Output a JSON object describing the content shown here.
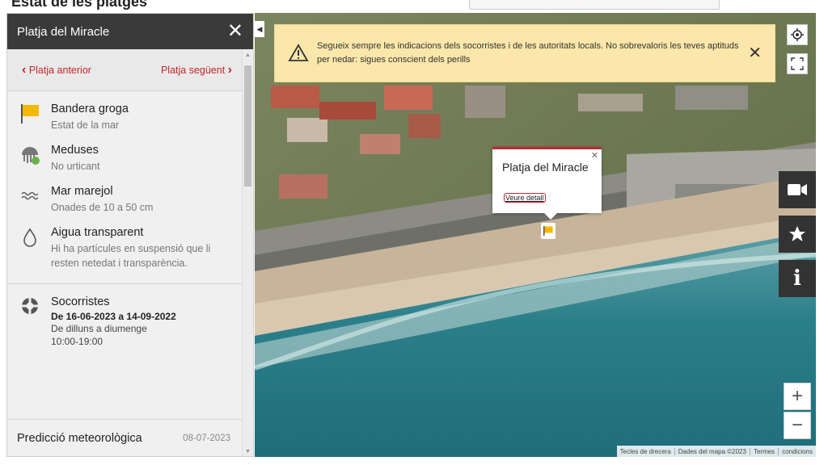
{
  "page": {
    "title": "Estat de les platges",
    "search_placeholder": "",
    "more_text": ""
  },
  "panel": {
    "title": "Platja del Miracle",
    "prev_label": "Platja anterior",
    "next_label": "Platja següent",
    "items": [
      {
        "title": "Bandera groga",
        "subtitle": "Estat de la mar"
      },
      {
        "title": "Meduses",
        "subtitle": "No urticant"
      },
      {
        "title": "Mar marejol",
        "subtitle": "Onades de 10 a 50 cm"
      },
      {
        "title": "Aigua transparent",
        "subtitle": "Hi ha partícules en suspensió que li resten netedat i transparència."
      }
    ],
    "lifeguards": {
      "title": "Socorristes",
      "dates": "De 16-06-2023 a 14-09-2022",
      "days": "De dilluns a diumenge",
      "hours": "10:00-19:00"
    },
    "forecast": {
      "label": "Predicció meteorològica",
      "date": "08-07-2023"
    }
  },
  "map": {
    "warning": "Segueix sempre les indicacions dels socorristes i de les autoritats locals. No sobrevaloris les teves aptituds per nedar: sigues conscient dels perills",
    "popup_title": "Platja del Miracle",
    "popup_link": "Veure detall",
    "zoom_in": "+",
    "zoom_out": "−",
    "attribution": [
      "Tecles de drecera",
      "Dades del mapa ©2023",
      "Termes",
      "condicions"
    ],
    "flag_color": "#f5b800"
  }
}
